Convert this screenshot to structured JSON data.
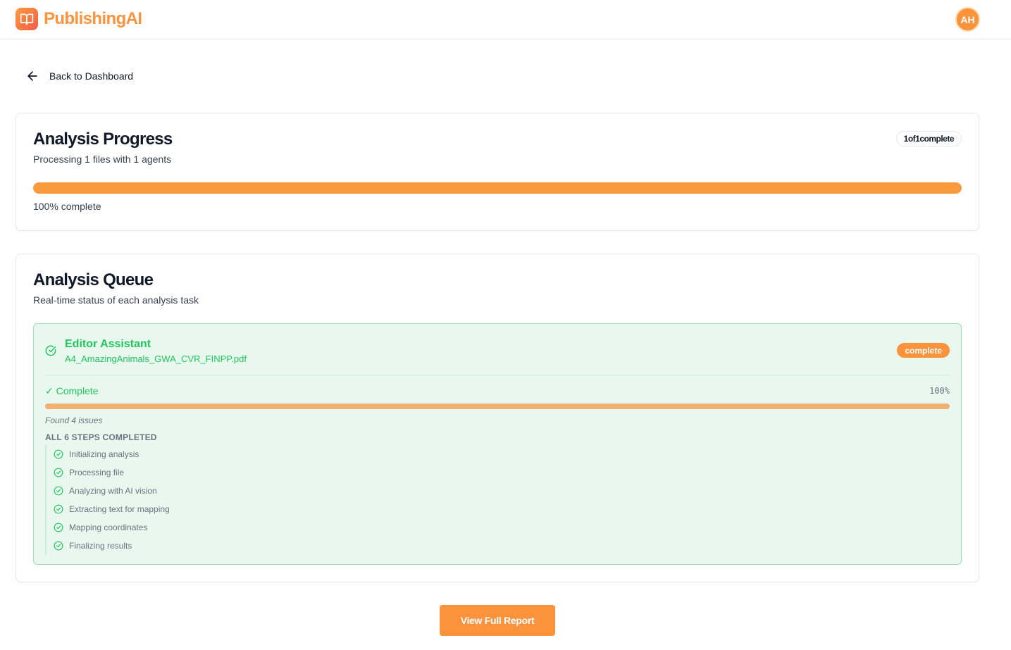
{
  "app": {
    "name": "PublishingAI",
    "logo_icon": "book-open-icon",
    "user_initials": "AH"
  },
  "nav": {
    "back_label": "Back to Dashboard",
    "back_icon": "arrow-left-icon"
  },
  "progress": {
    "title": "Analysis Progress",
    "subtitle": "Processing 1 files with 1 agents",
    "count_badge": "1of1complete",
    "percent": 100,
    "percent_label": "100% complete"
  },
  "queue": {
    "title": "Analysis Queue",
    "subtitle": "Real-time status of each analysis task",
    "tasks": [
      {
        "agent": "Editor Assistant",
        "file": "A4_AmazingAnimals_GWA_CVR_FINPP.pdf",
        "badge": "complete",
        "status": "✓ Complete",
        "percent_label": "100%",
        "percent": 100,
        "issues": "Found 4 issues",
        "steps_header": "ALL 6 STEPS COMPLETED",
        "steps": [
          "Initializing analysis",
          "Processing file",
          "Analyzing with AI vision",
          "Extracting text for mapping",
          "Mapping coordinates",
          "Finalizing results"
        ]
      }
    ]
  },
  "actions": {
    "report_label": "View Full Report"
  },
  "colors": {
    "accent": "#fb923c",
    "success": "#22c55e",
    "success_bg": "#e8f8ee"
  }
}
